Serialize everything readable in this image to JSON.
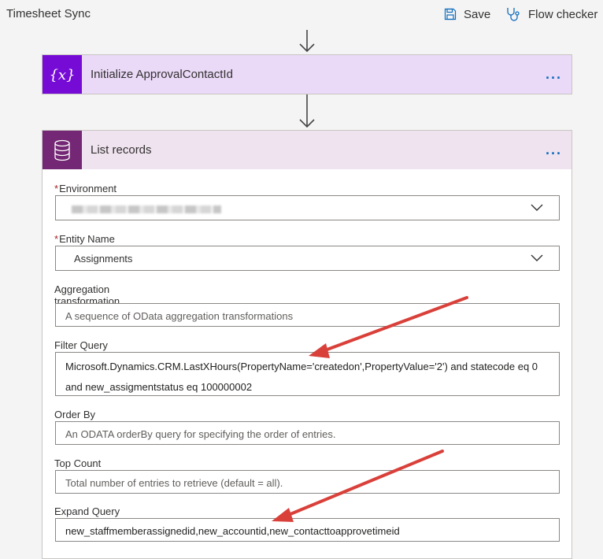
{
  "app": {
    "title": "Timesheet Sync",
    "save_label": "Save",
    "flow_checker_label": "Flow checker"
  },
  "init_card": {
    "icon": "variable-icon",
    "title": "Initialize ApprovalContactId",
    "more": "..."
  },
  "list_card": {
    "icon": "database-icon",
    "title": "List records",
    "more": "...",
    "fields": {
      "environment": {
        "label": "Environment",
        "required": "*"
      },
      "entity": {
        "label": "Entity Name",
        "required": "*",
        "value": "Assignments"
      },
      "aggregation": {
        "label": "Aggregation transformation",
        "placeholder": "A sequence of OData aggregation transformations"
      },
      "filter": {
        "label": "Filter Query",
        "line1": "Microsoft.Dynamics.CRM.LastXHours(PropertyName='createdon',PropertyValue='2') and statecode eq 0",
        "line2": "and new_assigmentstatus eq 100000002"
      },
      "order_by": {
        "label": "Order By",
        "placeholder": "An ODATA orderBy query for specifying the order of entries."
      },
      "top_count": {
        "label": "Top Count",
        "placeholder": "Total number of entries to retrieve (default = all)."
      },
      "expand": {
        "label": "Expand Query",
        "value": "new_staffmemberassignedid,new_accountid,new_contacttoapprovetimeid"
      }
    }
  },
  "colors": {
    "init_accent": "#770bd6",
    "list_accent": "#742774",
    "annotation_arrow": "#d9403a",
    "link_blue": "#0f6cbd"
  }
}
